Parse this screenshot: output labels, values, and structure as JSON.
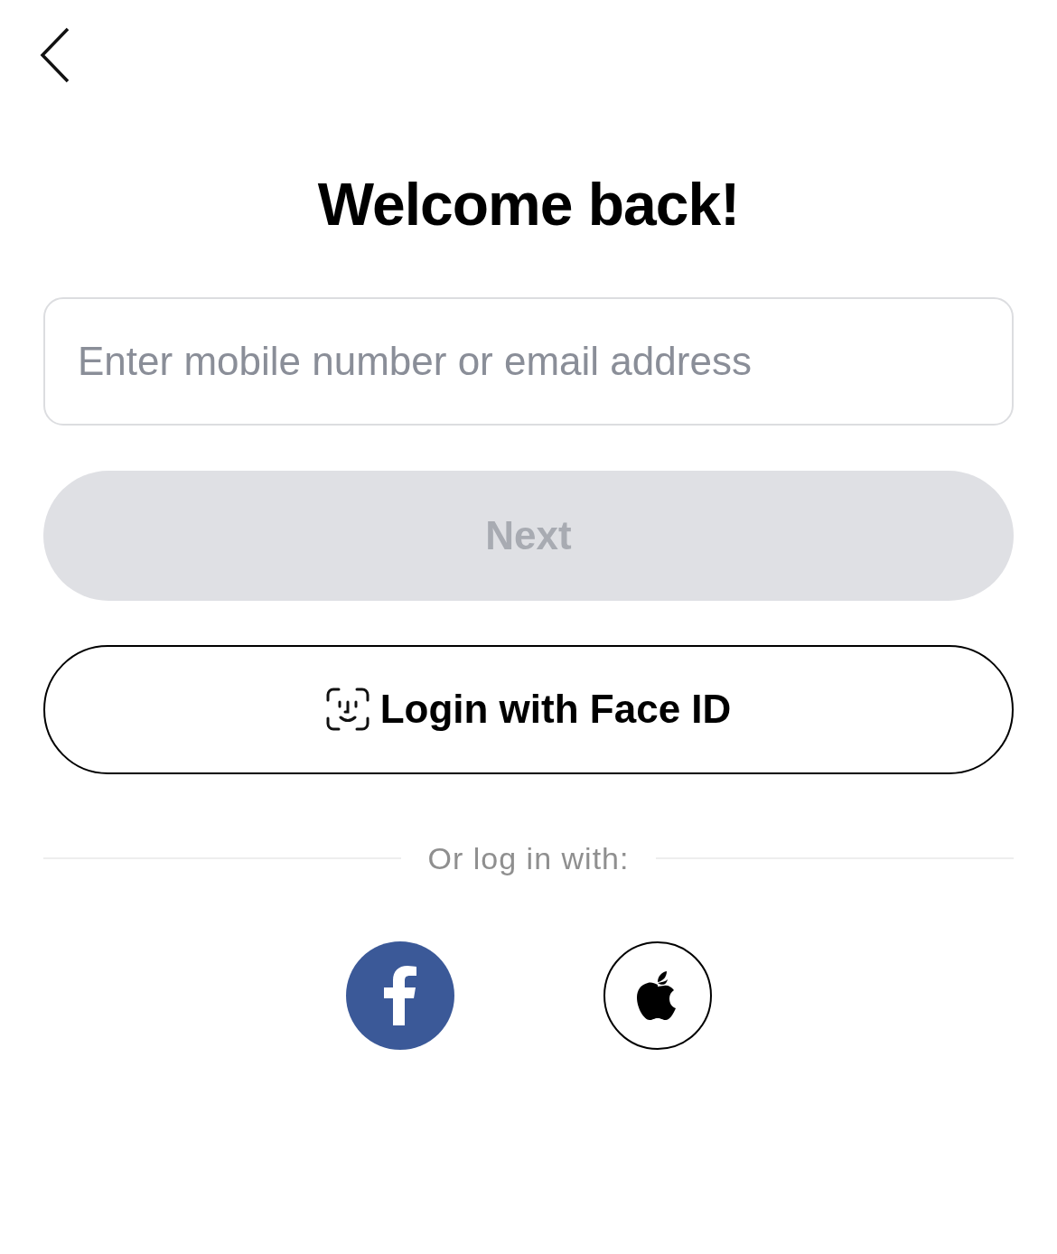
{
  "title": "Welcome back!",
  "login_field": {
    "placeholder": "Enter mobile number or email address"
  },
  "next_button": {
    "label": "Next",
    "disabled": true
  },
  "face_id_button": {
    "label": "Login with Face ID"
  },
  "divider_text": "Or log in with:",
  "social_logins": [
    {
      "kind": "facebook"
    },
    {
      "kind": "apple"
    }
  ]
}
